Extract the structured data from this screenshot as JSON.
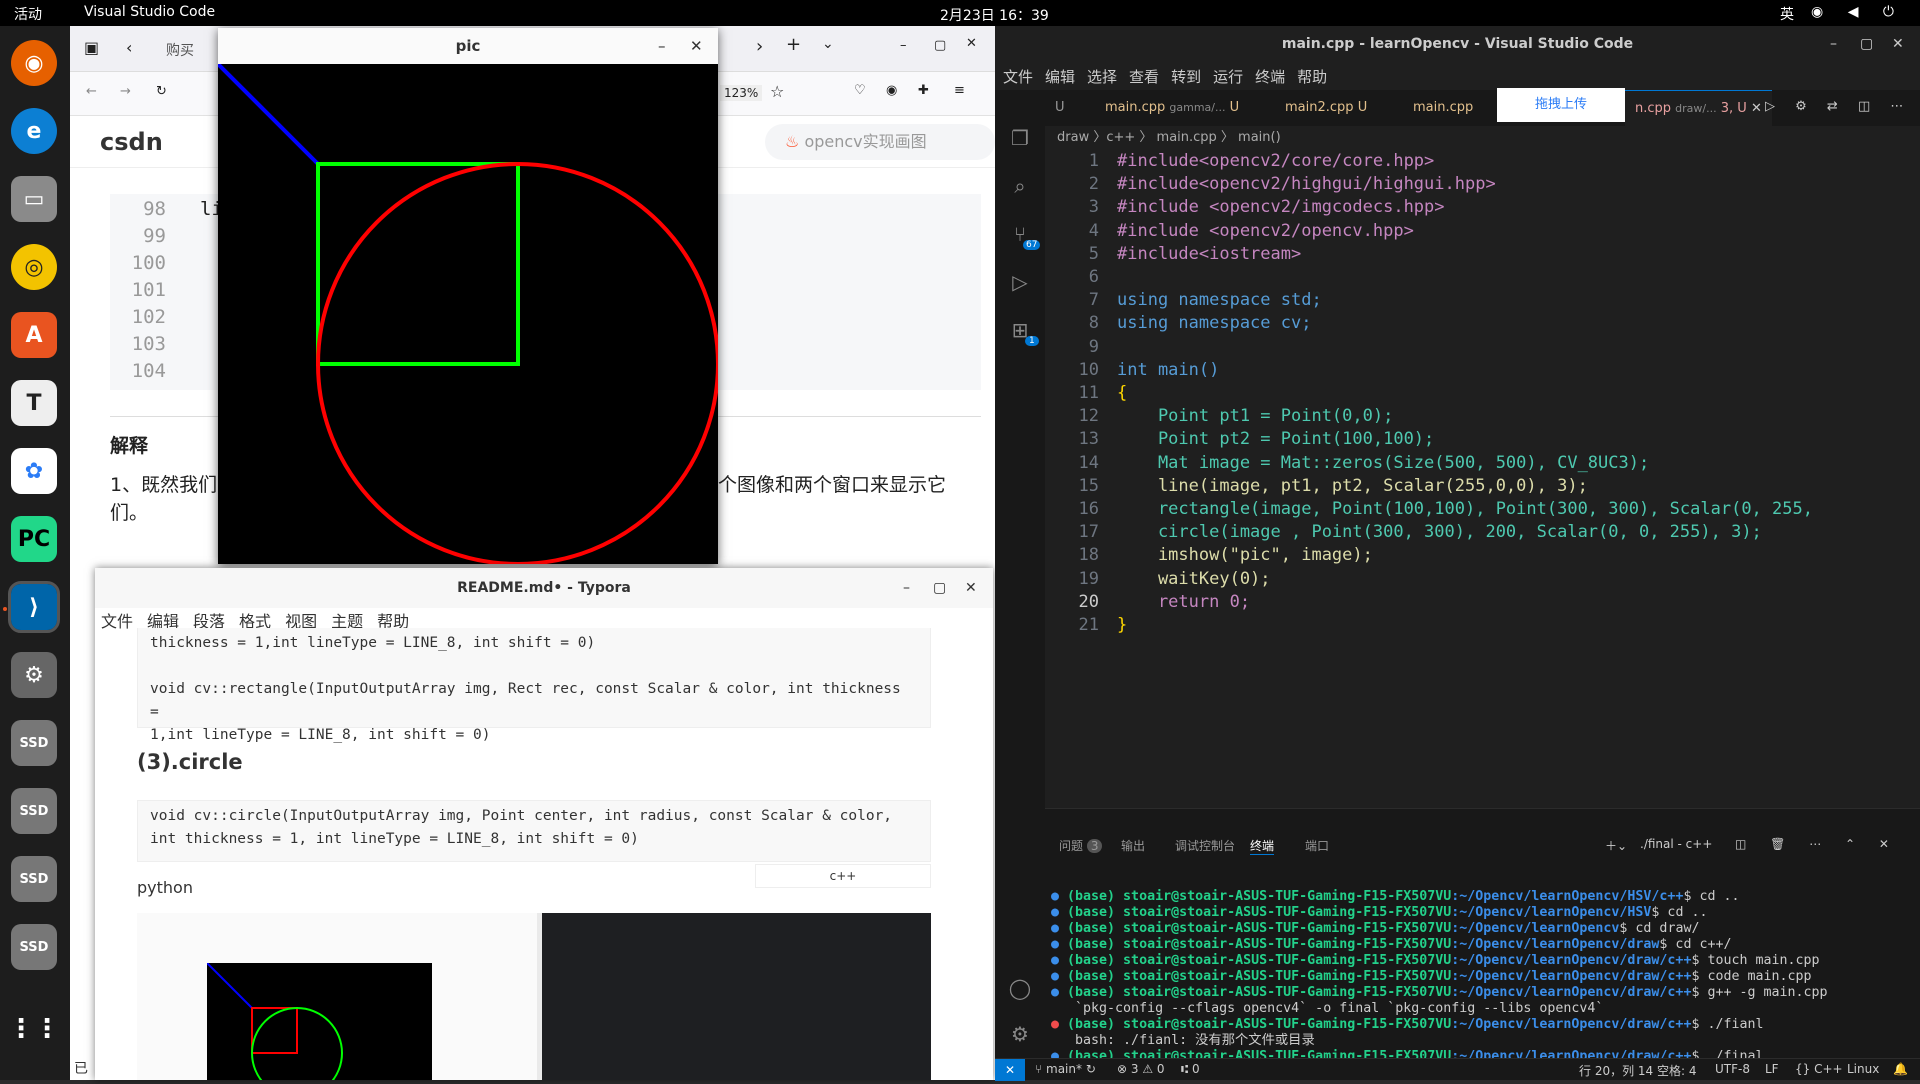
{
  "topbar": {
    "activities": "活动",
    "app": "Visual Studio Code",
    "clock": "2月23日  16：39",
    "ime": "英"
  },
  "browser": {
    "tab_label": "购买",
    "zoom": "123%",
    "logo": "csdn",
    "search": "opencv实现画图",
    "code_lines": [
      "98",
      "99",
      "100",
      "101",
      "102",
      "103",
      "104"
    ],
    "line98_text": "li",
    "closing_brace": "}",
    "heading": "解释",
    "para": "1、既然我们",
    "para_tail": "个图像和两个窗口来显示它",
    "para2": "们。",
    "status": "已"
  },
  "pic": {
    "title": "pic"
  },
  "typora": {
    "title": "README.md• - Typora",
    "menu": [
      "文件",
      "编辑",
      "段落",
      "格式",
      "视图",
      "主题",
      "帮助"
    ],
    "line_a": "thickness = 1,int  lineType = LINE_8, int  shift = 0)",
    "line_b": "void cv::rectangle(InputOutputArray img, Rect rec, const Scalar & color, int  thickness =",
    "line_c": "1,int  lineType = LINE_8, int  shift = 0)",
    "heading": "(3).circle",
    "line_d": "void cv::circle(InputOutputArray img, Point center,  int  radius, const Scalar & color,",
    "line_e": "int  thickness = 1, int  lineType = LINE_8, int  shift = 0)",
    "python": "python",
    "lang": "c++"
  },
  "vscode": {
    "title": "main.cpp - learnOpencv - Visual Studio Code",
    "menu": [
      "文件",
      "编辑",
      "选择",
      "查看",
      "转到",
      "运行",
      "终端",
      "帮助"
    ],
    "tabs": [
      "U",
      "main.cpp",
      "gamma/...",
      "U",
      "main2.cpp",
      "U",
      "main.cpp",
      "n.cpp",
      "draw/...",
      "3, U"
    ],
    "upload": "拖拽上传",
    "crumb": "draw 〉c++ 〉 main.cpp 〉 main()",
    "badges": {
      "scm": "67",
      "ext": "1"
    },
    "code": [
      "#include<opencv2/core/core.hpp>",
      "#include<opencv2/highgui/highgui.hpp>",
      "#include <opencv2/imgcodecs.hpp>",
      "#include <opencv2/opencv.hpp>",
      "#include<iostream>",
      "",
      "using namespace std;",
      "using namespace cv;",
      "",
      "int main()",
      "{",
      "    Point pt1 = Point(0,0);",
      "    Point pt2 = Point(100,100);",
      "    Mat image = Mat::zeros(Size(500, 500), CV_8UC3);",
      "    line(image, pt1, pt2, Scalar(255,0,0), 3);",
      "    rectangle(image, Point(100,100), Point(300, 300), Scalar(0, 255,",
      "    circle(image , Point(300, 300), 200, Scalar(0, 0, 255), 3);",
      "    imshow(\"pic\", image);",
      "    waitKey(0);",
      "    return 0;",
      "}"
    ],
    "panel_tabs": [
      "问题",
      "输出",
      "调试控制台",
      "终端",
      "端口"
    ],
    "problems_count": "3",
    "terminal_name": "./final - c++",
    "terminal": [
      {
        "user": "(base) stoair@stoair-ASUS-TUF-Gaming-F15-FX507VU",
        "path": ":~/Opencv/learnOpencv/HSV/c++",
        "cmd": "$ cd .."
      },
      {
        "user": "(base) stoair@stoair-ASUS-TUF-Gaming-F15-FX507VU",
        "path": ":~/Opencv/learnOpencv/HSV",
        "cmd": "$ cd .."
      },
      {
        "user": "(base) stoair@stoair-ASUS-TUF-Gaming-F15-FX507VU",
        "path": ":~/Opencv/learnOpencv",
        "cmd": "$ cd draw/"
      },
      {
        "user": "(base) stoair@stoair-ASUS-TUF-Gaming-F15-FX507VU",
        "path": ":~/Opencv/learnOpencv/draw",
        "cmd": "$ cd c++/"
      },
      {
        "user": "(base) stoair@stoair-ASUS-TUF-Gaming-F15-FX507VU",
        "path": ":~/Opencv/learnOpencv/draw/c++",
        "cmd": "$ touch main.cpp"
      },
      {
        "user": "(base) stoair@stoair-ASUS-TUF-Gaming-F15-FX507VU",
        "path": ":~/Opencv/learnOpencv/draw/c++",
        "cmd": "$ code main.cpp"
      },
      {
        "user": "(base) stoair@stoair-ASUS-TUF-Gaming-F15-FX507VU",
        "path": ":~/Opencv/learnOpencv/draw/c++",
        "cmd": "$ g++ -g main.cpp"
      },
      {
        "plain": " `pkg-config --cflags opencv4` -o final `pkg-config --libs opencv4`"
      },
      {
        "user": "(base) stoair@stoair-ASUS-TUF-Gaming-F15-FX507VU",
        "path": ":~/Opencv/learnOpencv/draw/c++",
        "cmd": "$ ./fianl"
      },
      {
        "plain": " bash: ./fianl: 没有那个文件或目录"
      },
      {
        "user": "(base) stoair@stoair-ASUS-TUF-Gaming-F15-FX507VU",
        "path": ":~/Opencv/learnOpencv/draw/c++",
        "cmd": "$ ./final"
      }
    ],
    "status": {
      "branch": "main*",
      "errors": "⊗ 3 ⚠ 0",
      "ports": "⑆ 0",
      "pos": "行 20，列 14",
      "spaces": "空格: 4",
      "enc": "UTF-8",
      "eol": "LF",
      "lang": "{} C++",
      "os": "Linux"
    }
  }
}
